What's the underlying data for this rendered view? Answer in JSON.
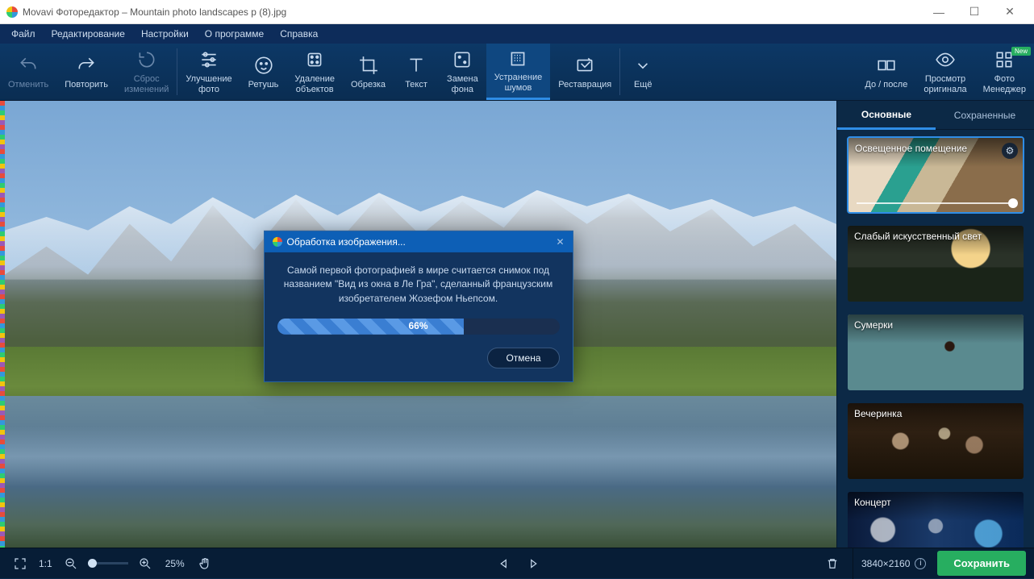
{
  "titlebar": {
    "title": "Movavi Фоторедактор – Mountain photo landscapes p (8).jpg"
  },
  "menu": {
    "file": "Файл",
    "edit": "Редактирование",
    "settings": "Настройки",
    "about": "О программе",
    "help": "Справка"
  },
  "toolbar": {
    "undo": "Отменить",
    "redo": "Повторить",
    "reset": "Сброс\nизменений",
    "enhance": "Улучшение\nфото",
    "retouch": "Ретушь",
    "remove": "Удаление\nобъектов",
    "crop": "Обрезка",
    "text": "Текст",
    "bgswap": "Замена\nфона",
    "denoise": "Устранение\nшумов",
    "restore": "Реставрация",
    "more": "Ещё",
    "beforeafter": "До / после",
    "original": "Просмотр\nоригинала",
    "manager": "Фото\nМенеджер",
    "new_badge": "New"
  },
  "side": {
    "tab_basic": "Основные",
    "tab_saved": "Сохраненные",
    "presets": [
      {
        "label": "Освещенное помещение",
        "selected": true,
        "gear": true,
        "slider": true
      },
      {
        "label": "Слабый искусственный свет"
      },
      {
        "label": "Сумерки"
      },
      {
        "label": "Вечеринка"
      },
      {
        "label": "Концерт"
      }
    ]
  },
  "dialog": {
    "title": "Обработка изображения...",
    "fact": "Самой первой фотографией в мире считается снимок под названием \"Вид из окна в Ле Гра\", сделанный французским изобретателем Жозефом Ньепсом.",
    "progress_pct": "66%",
    "cancel": "Отмена"
  },
  "status": {
    "ratio": "1:1",
    "zoom_pct": "25%",
    "dims": "3840×2160",
    "save": "Сохранить"
  }
}
